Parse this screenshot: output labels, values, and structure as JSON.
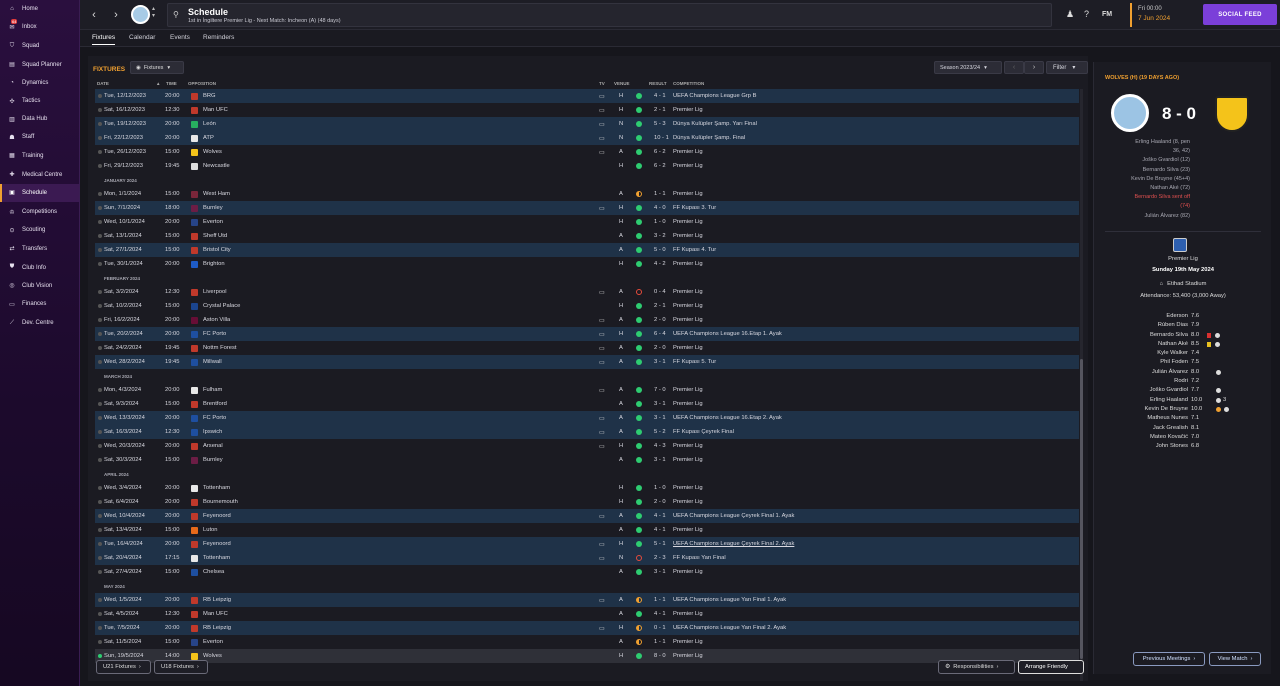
{
  "sidebar": {
    "items": [
      {
        "label": "Home",
        "icon": "home-icon"
      },
      {
        "label": "Inbox",
        "icon": "inbox-icon",
        "badge": "64"
      },
      {
        "label": "Squad",
        "icon": "squad-icon"
      },
      {
        "label": "Squad Planner",
        "icon": "squad-planner-icon"
      },
      {
        "label": "Dynamics",
        "icon": "dynamics-icon"
      },
      {
        "label": "Tactics",
        "icon": "tactics-icon"
      },
      {
        "label": "Data Hub",
        "icon": "data-hub-icon"
      },
      {
        "label": "Staff",
        "icon": "staff-icon"
      },
      {
        "label": "Training",
        "icon": "training-icon"
      },
      {
        "label": "Medical Centre",
        "icon": "medical-icon"
      },
      {
        "label": "Schedule",
        "icon": "schedule-icon",
        "active": true
      },
      {
        "label": "Competitions",
        "icon": "trophy-icon"
      },
      {
        "label": "Scouting",
        "icon": "scouting-icon"
      },
      {
        "label": "Transfers",
        "icon": "transfers-icon"
      },
      {
        "label": "Club Info",
        "icon": "club-info-icon"
      },
      {
        "label": "Club Vision",
        "icon": "club-vision-icon"
      },
      {
        "label": "Finances",
        "icon": "finances-icon"
      },
      {
        "label": "Dev. Centre",
        "icon": "dev-centre-icon"
      }
    ]
  },
  "header": {
    "title": "Schedule",
    "subtitle": "1st in İngiltere Premier Lig - Next Match: Incheon (A) (48 days)",
    "fm_label": "FM",
    "date_line1": "Fri 00:00",
    "date_line2": "7 Jun 2024",
    "social_label": "SOCIAL FEED"
  },
  "tabs": [
    "Fixtures",
    "Calendar",
    "Events",
    "Reminders"
  ],
  "fixtures": {
    "title": "FIXTURES",
    "view_dropdown": "Fixtures",
    "season": "Season 2023/24",
    "filter": "Filter",
    "headers": {
      "date": "DATE",
      "time": "TIME",
      "opposition": "OPPOSITION",
      "tv": "TV",
      "venue": "VENUE",
      "result": "RESULT",
      "competition": "COMPETITION"
    },
    "rows": [
      {
        "date": "Tue, 12/12/2023",
        "time": "20:00",
        "opp": "BRG",
        "crest": "#c0392b",
        "tv": true,
        "venue": "H",
        "res": "w",
        "score": "4 - 1",
        "comp": "UEFA Champions League Grp B",
        "hl": true
      },
      {
        "date": "Sat, 16/12/2023",
        "time": "12:30",
        "opp": "Man UFC",
        "crest": "#c0392b",
        "tv": true,
        "venue": "H",
        "res": "w",
        "score": "2 - 1",
        "comp": "Premier Lig"
      },
      {
        "date": "Tue, 19/12/2023",
        "time": "20:00",
        "opp": "León",
        "crest": "#27ae60",
        "tv": true,
        "venue": "N",
        "res": "w",
        "score": "5 - 3",
        "comp": "Dünya Kulüpler Şamp. Yarı Final",
        "hl": true
      },
      {
        "date": "Fri, 22/12/2023",
        "time": "20:00",
        "opp": "ATP",
        "crest": "#e8e8e8",
        "tv": true,
        "venue": "N",
        "res": "w",
        "score": "10 - 1",
        "comp": "Dünya Kulüpler Şamp. Final",
        "hl": true
      },
      {
        "date": "Tue, 26/12/2023",
        "time": "15:00",
        "opp": "Wolves",
        "crest": "#f4c31a",
        "tv": true,
        "venue": "A",
        "res": "w",
        "score": "6 - 2",
        "comp": "Premier Lig"
      },
      {
        "date": "Fri, 29/12/2023",
        "time": "19:45",
        "opp": "Newcastle",
        "crest": "#dddddd",
        "tv": false,
        "venue": "H",
        "res": "w",
        "score": "6 - 2",
        "comp": "Premier Lig"
      },
      {
        "month": "JANUARY 2024"
      },
      {
        "date": "Mon, 1/1/2024",
        "time": "15:00",
        "opp": "West Ham",
        "crest": "#7a263a",
        "tv": false,
        "venue": "A",
        "res": "d",
        "score": "1 - 1",
        "comp": "Premier Lig"
      },
      {
        "date": "Sun, 7/1/2024",
        "time": "18:00",
        "opp": "Burnley",
        "crest": "#6c1d45",
        "tv": true,
        "venue": "H",
        "res": "w",
        "score": "4 - 0",
        "comp": "FF Kupası 3. Tur",
        "hl": true
      },
      {
        "date": "Wed, 10/1/2024",
        "time": "20:00",
        "opp": "Everton",
        "crest": "#274488",
        "tv": false,
        "venue": "H",
        "res": "w",
        "score": "1 - 0",
        "comp": "Premier Lig"
      },
      {
        "date": "Sat, 13/1/2024",
        "time": "15:00",
        "opp": "Sheff Utd",
        "crest": "#c0392b",
        "tv": false,
        "venue": "A",
        "res": "w",
        "score": "3 - 2",
        "comp": "Premier Lig"
      },
      {
        "date": "Sat, 27/1/2024",
        "time": "15:00",
        "opp": "Bristol City",
        "crest": "#c0392b",
        "tv": false,
        "venue": "A",
        "res": "w",
        "score": "5 - 0",
        "comp": "FF Kupası 4. Tur",
        "hl": true
      },
      {
        "date": "Tue, 30/1/2024",
        "time": "20:00",
        "opp": "Brighton",
        "crest": "#1e5bc6",
        "tv": false,
        "venue": "H",
        "res": "w",
        "score": "4 - 2",
        "comp": "Premier Lig"
      },
      {
        "month": "FEBRUARY 2024"
      },
      {
        "date": "Sat, 3/2/2024",
        "time": "12:30",
        "opp": "Liverpool",
        "crest": "#c0392b",
        "tv": true,
        "venue": "A",
        "res": "l",
        "score": "0 - 4",
        "comp": "Premier Lig"
      },
      {
        "date": "Sat, 10/2/2024",
        "time": "15:00",
        "opp": "Crystal Palace",
        "crest": "#1b458f",
        "tv": false,
        "venue": "H",
        "res": "w",
        "score": "2 - 1",
        "comp": "Premier Lig"
      },
      {
        "date": "Fri, 16/2/2024",
        "time": "20:00",
        "opp": "Aston Villa",
        "crest": "#670e36",
        "tv": true,
        "venue": "A",
        "res": "w",
        "score": "2 - 0",
        "comp": "Premier Lig"
      },
      {
        "date": "Tue, 20/2/2024",
        "time": "20:00",
        "opp": "FC Porto",
        "crest": "#1e4fa0",
        "tv": true,
        "venue": "H",
        "res": "w",
        "score": "6 - 4",
        "comp": "UEFA Champions League 16.Etap 1. Ayak",
        "hl": true
      },
      {
        "date": "Sat, 24/2/2024",
        "time": "19:45",
        "opp": "Nottm Forest",
        "crest": "#c0392b",
        "tv": true,
        "venue": "A",
        "res": "w",
        "score": "2 - 0",
        "comp": "Premier Lig"
      },
      {
        "date": "Wed, 28/2/2024",
        "time": "19:45",
        "opp": "Millwall",
        "crest": "#1e4fa0",
        "tv": true,
        "venue": "A",
        "res": "w",
        "score": "3 - 1",
        "comp": "FF Kupası 5. Tur",
        "hl": true
      },
      {
        "month": "MARCH 2024"
      },
      {
        "date": "Mon, 4/3/2024",
        "time": "20:00",
        "opp": "Fulham",
        "crest": "#e8e8e8",
        "tv": true,
        "venue": "A",
        "res": "w",
        "score": "7 - 0",
        "comp": "Premier Lig"
      },
      {
        "date": "Sat, 9/3/2024",
        "time": "15:00",
        "opp": "Brentford",
        "crest": "#c0392b",
        "tv": false,
        "venue": "A",
        "res": "w",
        "score": "3 - 1",
        "comp": "Premier Lig"
      },
      {
        "date": "Wed, 13/3/2024",
        "time": "20:00",
        "opp": "FC Porto",
        "crest": "#1e4fa0",
        "tv": true,
        "venue": "A",
        "res": "w",
        "score": "3 - 1",
        "comp": "UEFA Champions League 16.Etap 2. Ayak",
        "hl": true
      },
      {
        "date": "Sat, 16/3/2024",
        "time": "12:30",
        "opp": "Ipswich",
        "crest": "#1e4fa0",
        "tv": true,
        "venue": "A",
        "res": "w",
        "score": "5 - 2",
        "comp": "FF Kupası Çeyrek Final",
        "hl": true
      },
      {
        "date": "Wed, 20/3/2024",
        "time": "20:00",
        "opp": "Arsenal",
        "crest": "#c0392b",
        "tv": true,
        "venue": "H",
        "res": "w",
        "score": "4 - 3",
        "comp": "Premier Lig"
      },
      {
        "date": "Sat, 30/3/2024",
        "time": "15:00",
        "opp": "Burnley",
        "crest": "#6c1d45",
        "tv": false,
        "venue": "A",
        "res": "w",
        "score": "3 - 1",
        "comp": "Premier Lig"
      },
      {
        "month": "APRIL 2024"
      },
      {
        "date": "Wed, 3/4/2024",
        "time": "20:00",
        "opp": "Tottenham",
        "crest": "#e8e8e8",
        "tv": false,
        "venue": "H",
        "res": "w",
        "score": "1 - 0",
        "comp": "Premier Lig"
      },
      {
        "date": "Sat, 6/4/2024",
        "time": "20:00",
        "opp": "Bournemouth",
        "crest": "#c0392b",
        "tv": false,
        "venue": "H",
        "res": "w",
        "score": "2 - 0",
        "comp": "Premier Lig"
      },
      {
        "date": "Wed, 10/4/2024",
        "time": "20:00",
        "opp": "Feyenoord",
        "crest": "#c0392b",
        "tv": true,
        "venue": "A",
        "res": "w",
        "score": "4 - 1",
        "comp": "UEFA Champions League Çeyrek Final 1. Ayak",
        "hl": true
      },
      {
        "date": "Sat, 13/4/2024",
        "time": "15:00",
        "opp": "Luton",
        "crest": "#e86a1a",
        "tv": false,
        "venue": "A",
        "res": "w",
        "score": "4 - 1",
        "comp": "Premier Lig"
      },
      {
        "date": "Tue, 16/4/2024",
        "time": "20:00",
        "opp": "Feyenoord",
        "crest": "#c0392b",
        "tv": true,
        "venue": "H",
        "res": "w",
        "score": "5 - 1",
        "comp": "UEFA Champions League Çeyrek Final 2. Ayak",
        "hl": true,
        "underline": true
      },
      {
        "date": "Sat, 20/4/2024",
        "time": "17:15",
        "opp": "Tottenham",
        "crest": "#e8e8e8",
        "tv": true,
        "venue": "N",
        "res": "l",
        "score": "2 - 3",
        "comp": "FF Kupası Yarı Final",
        "hl": true
      },
      {
        "date": "Sat, 27/4/2024",
        "time": "15:00",
        "opp": "Chelsea",
        "crest": "#1e4fa0",
        "tv": false,
        "venue": "A",
        "res": "w",
        "score": "3 - 1",
        "comp": "Premier Lig"
      },
      {
        "month": "MAY 2024"
      },
      {
        "date": "Wed, 1/5/2024",
        "time": "20:00",
        "opp": "RB Leipzig",
        "crest": "#c0392b",
        "tv": true,
        "venue": "A",
        "res": "d",
        "score": "1 - 1",
        "comp": "UEFA Champions League Yarı Final 1. Ayak",
        "hl": true
      },
      {
        "date": "Sat, 4/5/2024",
        "time": "12:30",
        "opp": "Man UFC",
        "crest": "#c0392b",
        "tv": false,
        "venue": "A",
        "res": "w",
        "score": "4 - 1",
        "comp": "Premier Lig"
      },
      {
        "date": "Tue, 7/5/2024",
        "time": "20:00",
        "opp": "RB Leipzig",
        "crest": "#c0392b",
        "tv": true,
        "venue": "H",
        "res": "d",
        "score": "0 - 1",
        "comp": "UEFA Champions League Yarı Final 2. Ayak",
        "hl": true
      },
      {
        "date": "Sat, 11/5/2024",
        "time": "15:00",
        "opp": "Everton",
        "crest": "#274488",
        "tv": false,
        "venue": "A",
        "res": "d",
        "score": "1 - 1",
        "comp": "Premier Lig"
      },
      {
        "date": "Sun, 19/5/2024",
        "time": "14:00",
        "opp": "Wolves",
        "crest": "#f4c31a",
        "tv": false,
        "venue": "H",
        "res": "w",
        "score": "8 - 0",
        "comp": "Premier Lig",
        "last": true
      }
    ],
    "bottom": {
      "u21": "U21 Fixtures",
      "u18": "U18 Fixtures",
      "responsibilities": "Responsibilities",
      "arrange": "Arrange Friendly"
    }
  },
  "match_panel": {
    "header": "WOLVES (H) (19 DAYS AGO)",
    "score": "8 - 0",
    "scorers": [
      "Erling Haaland (8, pen",
      "36, 42)",
      "Joško Gvardiol (12)",
      "Bernardo Silva (23)",
      "Kevin De Bruyne (45+4)",
      "Nathan Aké (72)",
      "Bernardo Silva sent off",
      "(74)",
      "Julián Álvarez (82)"
    ],
    "competition": "Premier Lig",
    "date": "Sunday 19th May 2024",
    "stadium": "Etihad Stadium",
    "attendance": "Attendance: 53,400 (3,000 Away)",
    "ratings": [
      {
        "name": "Ederson",
        "val": "7.6"
      },
      {
        "name": "Rúben Dias",
        "val": "7.9"
      },
      {
        "name": "Bernardo Silva",
        "val": "8.0",
        "card": "#d93030",
        "ball": true
      },
      {
        "name": "Nathan Aké",
        "val": "8.5",
        "card": "#e8c020",
        "ball": true
      },
      {
        "name": "Kyle Walker",
        "val": "7.4"
      },
      {
        "name": "Phil Foden",
        "val": "7.5"
      },
      {
        "name": "Julián Álvarez",
        "val": "8.0",
        "ball": true
      },
      {
        "name": "Rodri",
        "val": "7.2"
      },
      {
        "name": "Joško Gvardiol",
        "val": "7.7",
        "ball": true
      },
      {
        "name": "Erling Haaland",
        "val": "10.0",
        "ball": true,
        "count": "3"
      },
      {
        "name": "Kevin De Bruyne",
        "val": "10.0",
        "ball": true,
        "star": true
      },
      {
        "name": "Matheus Nunes",
        "val": "7.1"
      },
      {
        "name": "Jack Grealish",
        "val": "8.1"
      },
      {
        "name": "Mateo Kovačić",
        "val": "7.0"
      },
      {
        "name": "John Stones",
        "val": "6.8"
      }
    ],
    "prev_meetings": "Previous Meetings",
    "view_match": "View Match"
  }
}
